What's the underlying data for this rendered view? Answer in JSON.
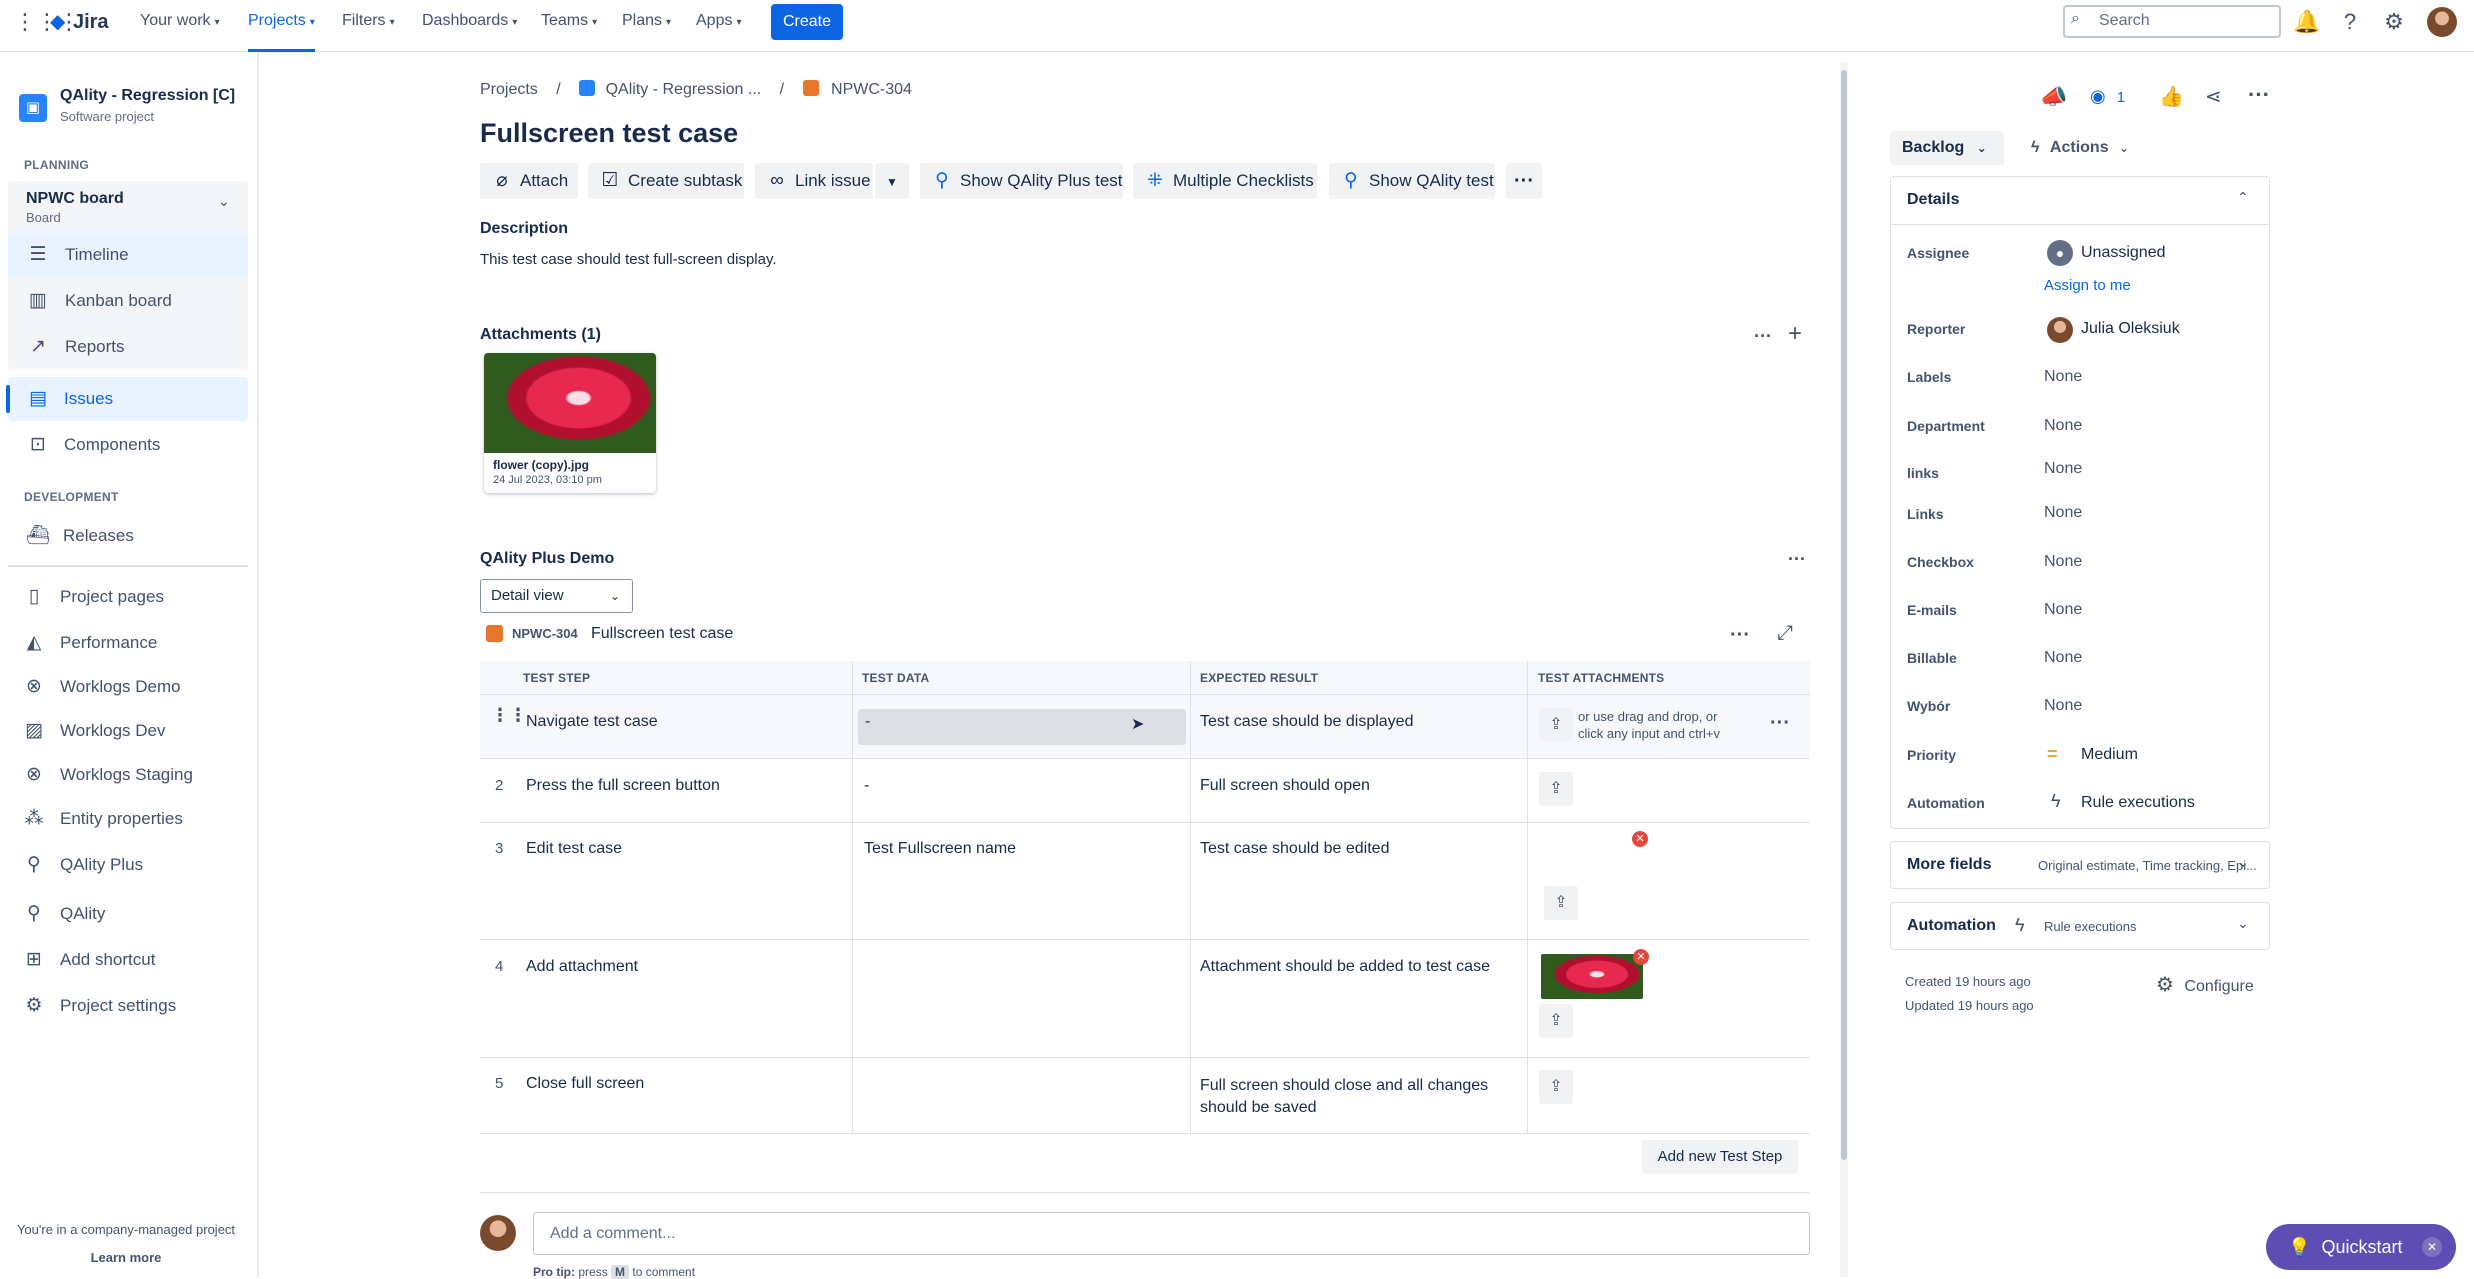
{
  "topnav": {
    "logo": "Jira",
    "items": [
      "Your work",
      "Projects",
      "Filters",
      "Dashboards",
      "Teams",
      "Plans",
      "Apps"
    ],
    "create": "Create",
    "search_placeholder": "Search"
  },
  "sidebar": {
    "project_name": "QAlity - Regression [C]",
    "project_type": "Software project",
    "planning": "PLANNING",
    "board_name": "NPWC board",
    "board_sub": "Board",
    "timeline": "Timeline",
    "kanban": "Kanban board",
    "reports": "Reports",
    "issues": "Issues",
    "components": "Components",
    "development": "DEVELOPMENT",
    "releases": "Releases",
    "project_pages": "Project pages",
    "performance": "Performance",
    "worklogs_demo": "Worklogs Demo",
    "worklogs_dev": "Worklogs Dev",
    "worklogs_staging": "Worklogs Staging",
    "entity_properties": "Entity properties",
    "qality_plus": "QAlity Plus",
    "qality": "QAlity",
    "add_shortcut": "Add shortcut",
    "project_settings": "Project settings",
    "footer_text": "You're in a company-managed project",
    "learn_more": "Learn more"
  },
  "breadcrumb": {
    "projects": "Projects",
    "project": "QAlity - Regression ...",
    "issue": "NPWC-304",
    "sep": "/"
  },
  "issue": {
    "title": "Fullscreen test case",
    "toolbar": {
      "attach": "Attach",
      "subtask": "Create subtask",
      "link": "Link issue",
      "show_plus": "Show QAlity Plus test",
      "checklists": "Multiple Checklists",
      "show_test": "Show QAlity test"
    },
    "description_label": "Description",
    "description": "This test case should test full-screen display."
  },
  "attachments": {
    "heading": "Attachments (1)",
    "file_name": "flower (copy).jpg",
    "file_date": "24 Jul 2023, 03:10 pm"
  },
  "qality": {
    "heading": "QAlity Plus Demo",
    "view": "Detail view",
    "key": "NPWC-304",
    "name": "Fullscreen test case",
    "columns": [
      "TEST STEP",
      "TEST DATA",
      "EXPECTED RESULT",
      "TEST ATTACHMENTS"
    ],
    "rows": [
      {
        "num": "",
        "step": "Navigate test case",
        "data": "-",
        "expected": "Test case should be displayed",
        "attach": "or use drag and drop, or click any input and ctrl+v"
      },
      {
        "num": "2",
        "step": "Press the full screen button",
        "data": "-",
        "expected": "Full screen should open"
      },
      {
        "num": "3",
        "step": "Edit test case",
        "data": "Test Fullscreen name",
        "expected": "Test case should be edited"
      },
      {
        "num": "4",
        "step": "Add attachment",
        "data": "",
        "expected": "Attachment should be added to test case"
      },
      {
        "num": "5",
        "step": "Close full screen",
        "data": "",
        "expected": "Full screen should close and all changes should be saved"
      }
    ],
    "add_step": "Add new Test Step"
  },
  "comment": {
    "placeholder": "Add a comment...",
    "tip_prefix": "Pro tip:",
    "tip_press": "press",
    "tip_key": "M",
    "tip_suffix": "to comment"
  },
  "right": {
    "watch_count": "1",
    "status": "Backlog",
    "actions": "Actions",
    "details": "Details",
    "fields": [
      {
        "k": "Assignee",
        "v": "Unassigned"
      },
      {
        "k": "Reporter",
        "v": "Julia Oleksiuk"
      },
      {
        "k": "Labels",
        "v": "None"
      },
      {
        "k": "Department",
        "v": "None"
      },
      {
        "k": "links",
        "v": "None"
      },
      {
        "k": "Links",
        "v": "None"
      },
      {
        "k": "Checkbox",
        "v": "None"
      },
      {
        "k": "E-mails",
        "v": "None"
      },
      {
        "k": "Billable",
        "v": "None"
      },
      {
        "k": "Wybór",
        "v": "None"
      },
      {
        "k": "Priority",
        "v": "Medium"
      },
      {
        "k": "Automation",
        "v": "Rule executions"
      }
    ],
    "assign_to_me": "Assign to me",
    "more_fields": "More fields",
    "more_fields_sub": "Original estimate, Time tracking, Epi...",
    "automation": "Automation",
    "automation_sub": "Rule executions",
    "created": "Created 19 hours ago",
    "updated": "Updated 19 hours ago",
    "configure": "Configure"
  },
  "quickstart": "Quickstart"
}
